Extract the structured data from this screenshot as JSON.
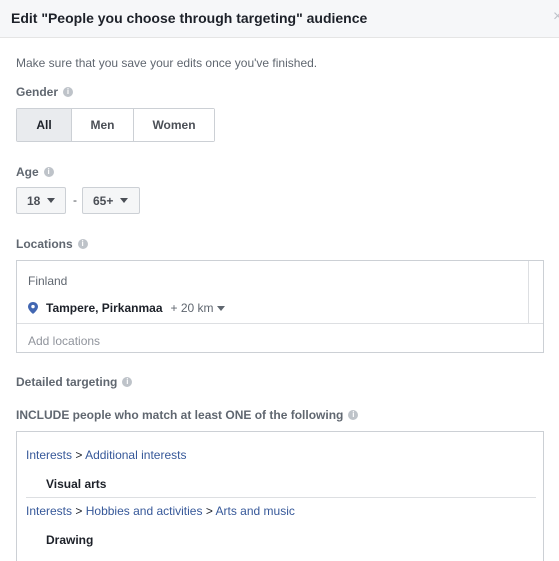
{
  "dialog": {
    "title": "Edit \"People you choose through targeting\" audience",
    "close_glyph": "×"
  },
  "note": "Make sure that you save your edits once you've finished.",
  "gender": {
    "label": "Gender",
    "options": [
      "All",
      "Men",
      "Women"
    ],
    "selected": "All"
  },
  "age": {
    "label": "Age",
    "min": "18",
    "separator": "-",
    "max": "65+"
  },
  "locations": {
    "label": "Locations",
    "country": "Finland",
    "item": "Tampere, Pirkanmaa",
    "radius": "+ 20 km",
    "add_placeholder": "Add locations"
  },
  "detailed_targeting": {
    "label": "Detailed targeting",
    "include_label": "INCLUDE people who match at least ONE of the following",
    "groups": [
      {
        "path": [
          "Interests",
          "Additional interests"
        ],
        "item": "Visual arts"
      },
      {
        "path": [
          "Interests",
          "Hobbies and activities",
          "Arts and music"
        ],
        "item": "Drawing"
      }
    ],
    "path_separator": ">"
  },
  "colors": {
    "link": "#365899",
    "pin": "#4267b2",
    "selected_bg": "#e9ebee"
  },
  "icons": {
    "info": "info-icon",
    "pin": "location-pin-icon",
    "caret": "caret-down-icon",
    "close": "close-icon"
  }
}
